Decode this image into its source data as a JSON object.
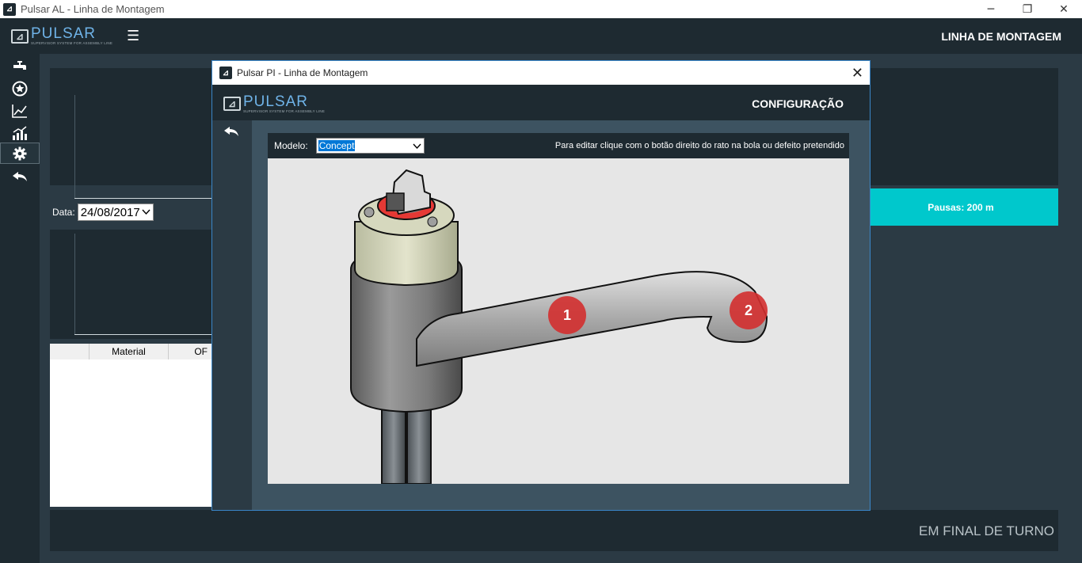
{
  "os_window": {
    "title": "Pulsar AL - Linha de Montagem",
    "icon": "app-logo-icon",
    "controls": [
      "minimize",
      "restore",
      "close"
    ]
  },
  "app": {
    "logo_name": "PULSAR",
    "logo_tagline": "SUPERVISOR SYSTEM FOR ASSEMBLY LINE",
    "title": "LINHA DE MONTAGEM",
    "menu_icon": "hamburger-icon"
  },
  "sidebar": {
    "items": [
      {
        "icon": "faucet-icon",
        "active": false
      },
      {
        "icon": "star-circle-icon",
        "active": false
      },
      {
        "icon": "line-chart-icon",
        "active": false
      },
      {
        "icon": "growth-chart-icon",
        "active": false
      },
      {
        "icon": "gear-icon",
        "active": true
      },
      {
        "icon": "back-arrow-icon",
        "active": false
      }
    ]
  },
  "background": {
    "date_label": "Data:",
    "date_value": "24/08/2017",
    "table_columns": [
      "",
      "Material",
      "OF"
    ],
    "pausas": "Pausas: 200 m",
    "status": "EM FINAL DE TURNO"
  },
  "modal": {
    "window_title": "Pulsar PI - Linha de Montagem",
    "title": "CONFIGURAÇÃO",
    "modelo_label": "Modelo:",
    "modelo_value": "Concept",
    "hint": "Para editar clique com o botão direito do rato na bola ou defeito pretendido",
    "markers": [
      {
        "label": "1",
        "color": "#d32f2f"
      },
      {
        "label": "2",
        "color": "#d32f2f"
      }
    ]
  }
}
